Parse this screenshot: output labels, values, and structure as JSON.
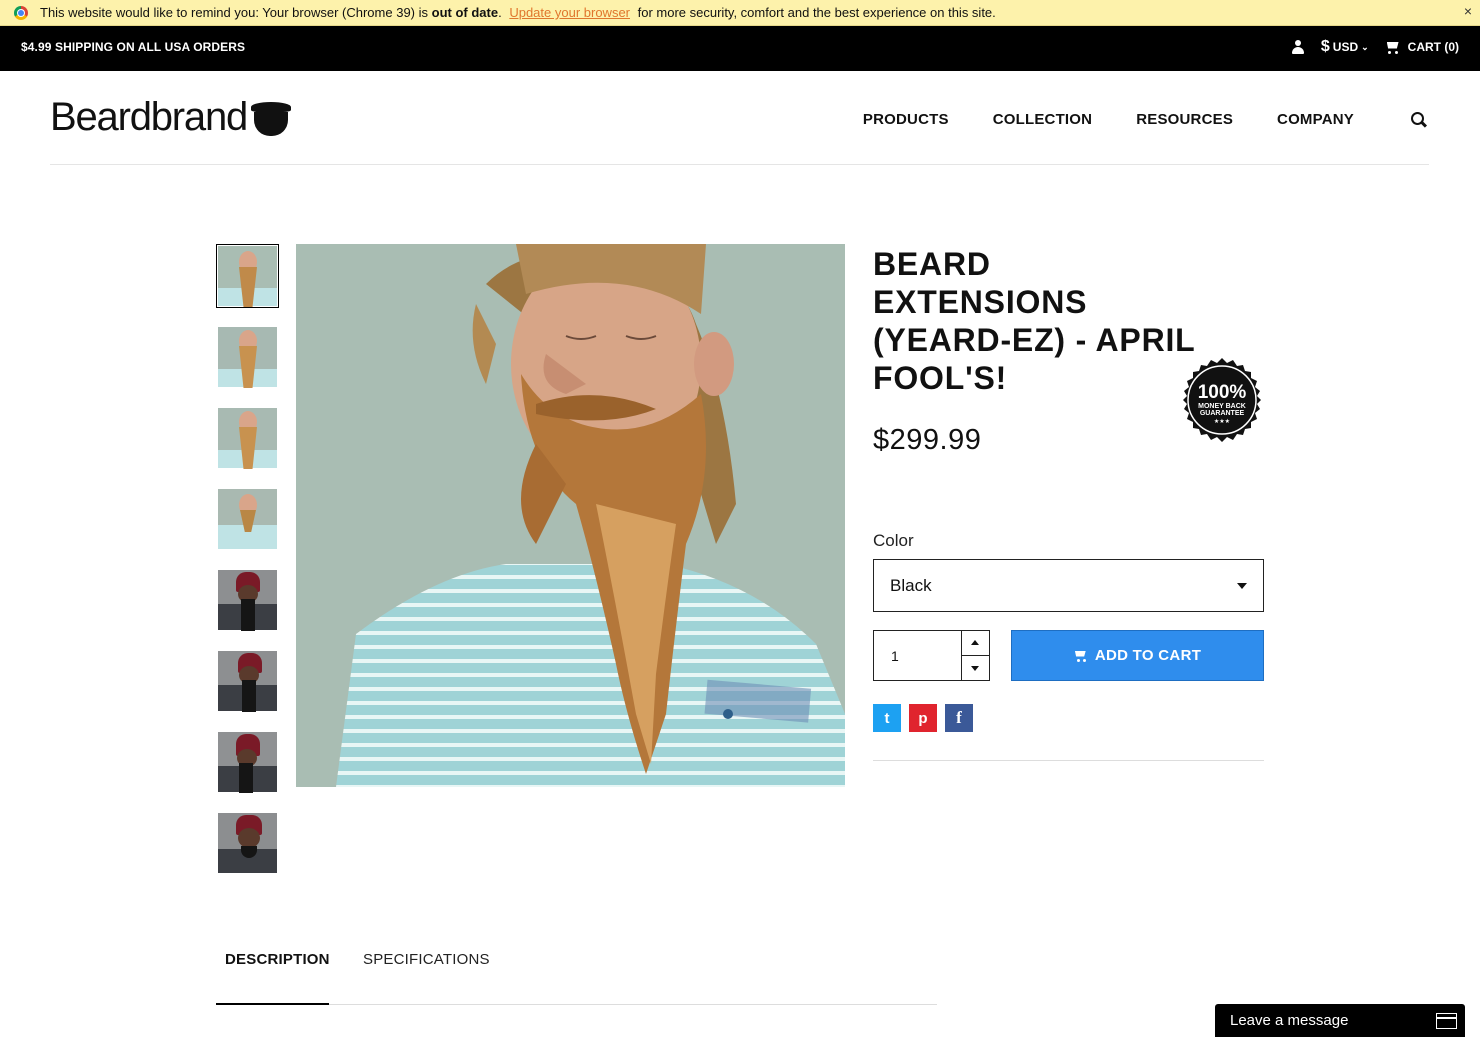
{
  "browser_warning": {
    "prefix": "This website would like to remind you: Your browser (Chrome 39) is",
    "bold": "out of date",
    "period": ".",
    "link": "Update your browser",
    "suffix": "for more security, comfort and the best experience on this site.",
    "close": "×"
  },
  "top_bar": {
    "shipping": "$4.99 SHIPPING ON ALL USA ORDERS",
    "currency_symbol": "$",
    "currency": "USD",
    "cart": "CART (0)"
  },
  "header": {
    "logo": "Beardbrand",
    "nav": [
      "PRODUCTS",
      "COLLECTION",
      "RESOURCES",
      "COMPANY"
    ]
  },
  "product": {
    "title": "BEARD EXTENSIONS (YEARD-EZ) - APRIL FOOL'S!",
    "price": "$299.99",
    "badge": {
      "percent": "100%",
      "line1": "MONEY BACK",
      "line2": "GUARANTEE",
      "stars": "★★★"
    },
    "color_label": "Color",
    "color_value": "Black",
    "quantity": "1",
    "add_to_cart": "ADD TO CART",
    "share": {
      "twitter": "t",
      "pinterest": "p",
      "facebook": "f"
    }
  },
  "tabs": [
    "DESCRIPTION",
    "SPECIFICATIONS"
  ],
  "chat": {
    "label": "Leave a message"
  },
  "colors": {
    "accent": "#2f8ded",
    "warning_bg": "#fdf2ab",
    "top_bar": "#000000"
  }
}
